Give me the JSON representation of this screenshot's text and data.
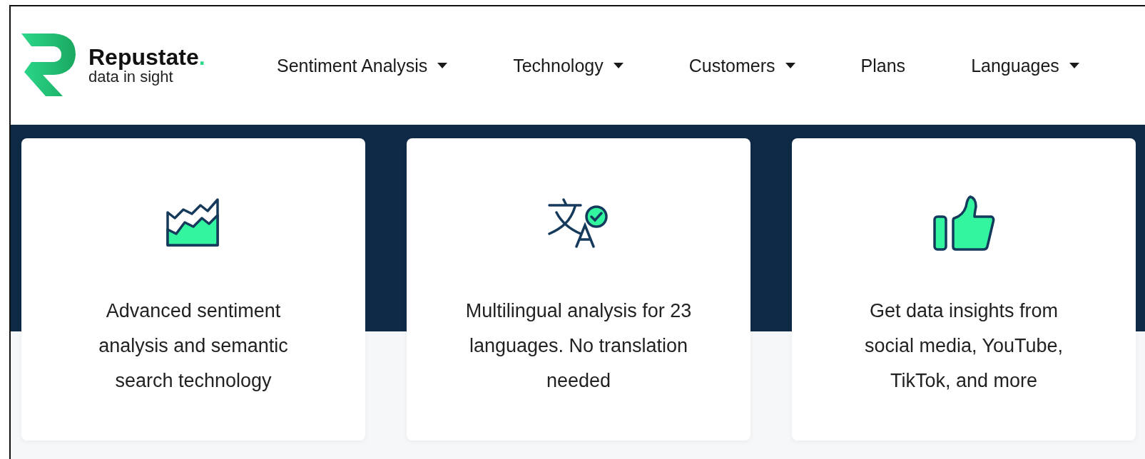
{
  "logo": {
    "name": "Repustate",
    "dot": ".",
    "tagline": "data in sight"
  },
  "nav": [
    {
      "label": "Sentiment Analysis",
      "dropdown": true
    },
    {
      "label": "Technology",
      "dropdown": true
    },
    {
      "label": "Customers",
      "dropdown": true
    },
    {
      "label": "Plans",
      "dropdown": false
    },
    {
      "label": "Languages",
      "dropdown": true
    }
  ],
  "cards": [
    {
      "kind": "chart",
      "text": "Advanced sentiment analysis and semantic search technology"
    },
    {
      "kind": "translate",
      "text": "Multilingual analysis for 23 languages. No translation needed"
    },
    {
      "kind": "thumbs_up",
      "text": "Get data insights from social media, YouTube, TikTok, and more"
    }
  ]
}
